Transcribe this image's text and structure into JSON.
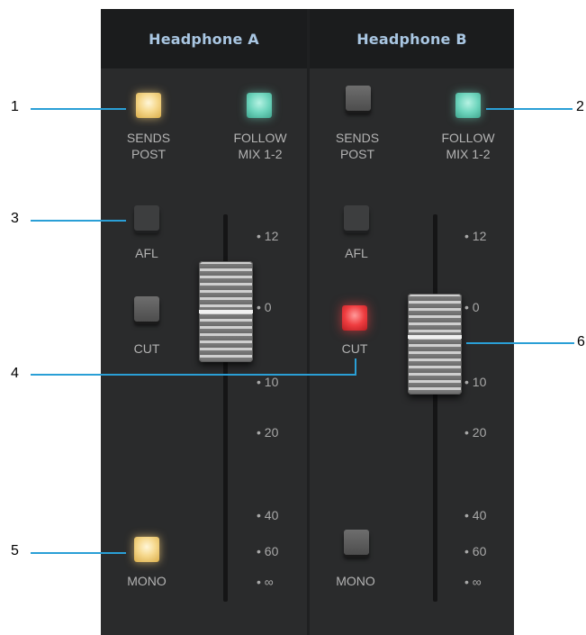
{
  "channels": [
    {
      "title": "Headphone A",
      "sends_post": {
        "label": "SENDS\nPOST",
        "state": "on",
        "color": "#f6d98e"
      },
      "follow_mix": {
        "label": "FOLLOW\nMIX 1-2",
        "state": "on",
        "color": "#6ed5bd"
      },
      "afl": {
        "label": "AFL",
        "state": "off"
      },
      "cut": {
        "label": "CUT",
        "state": "off"
      },
      "mono": {
        "label": "MONO",
        "state": "on",
        "color": "#f6d98e"
      },
      "scale": [
        "12",
        "0",
        "10",
        "20",
        "40",
        "60",
        "∞"
      ]
    },
    {
      "title": "Headphone B",
      "sends_post": {
        "label": "SENDS\nPOST",
        "state": "off"
      },
      "follow_mix": {
        "label": "FOLLOW\nMIX 1-2",
        "state": "on",
        "color": "#6ed5bd"
      },
      "afl": {
        "label": "AFL",
        "state": "off"
      },
      "cut": {
        "label": "CUT",
        "state": "on",
        "color": "#ef3d40"
      },
      "mono": {
        "label": "MONO",
        "state": "off"
      },
      "scale": [
        "12",
        "0",
        "10",
        "20",
        "40",
        "60",
        "∞"
      ]
    }
  ],
  "callouts": [
    "1",
    "2",
    "3",
    "4",
    "5",
    "6"
  ],
  "colors": {
    "header_text": "#a9c6e2",
    "panel_bg": "#2a2b2c",
    "header_bg": "#1b1c1d",
    "callout_line": "#2a9fd6"
  }
}
